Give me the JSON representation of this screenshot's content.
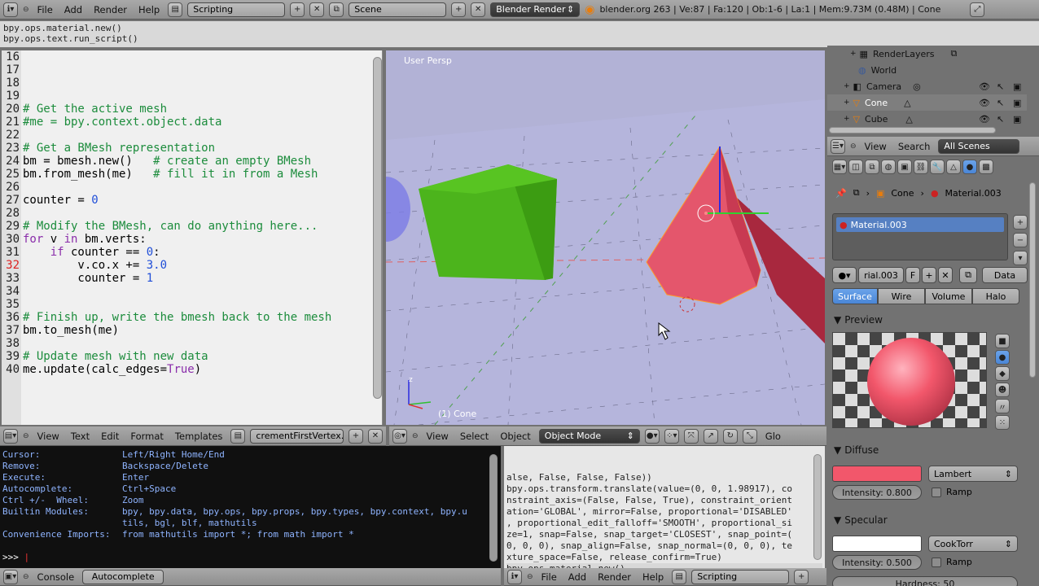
{
  "top_bar": {
    "menus": [
      "File",
      "Add",
      "Render",
      "Help"
    ],
    "layout": "Scripting",
    "scene": "Scene",
    "engine": "Blender Render",
    "stats": "blender.org 263 | Ve:87 | Fa:120 | Ob:1-6 | La:1 | Mem:9.73M (0.48M) | Cone"
  },
  "info_log": [
    "bpy.ops.material.new()",
    "bpy.ops.text.run_script()"
  ],
  "text_editor": {
    "lines": [
      {
        "n": "16",
        "segs": []
      },
      {
        "n": "17",
        "segs": []
      },
      {
        "n": "18",
        "segs": []
      },
      {
        "n": "19",
        "segs": []
      },
      {
        "n": "20",
        "segs": [
          {
            "t": "# Get the active mesh",
            "c": "cm"
          }
        ]
      },
      {
        "n": "21",
        "segs": [
          {
            "t": "#me = bpy.context.object.data",
            "c": "cm"
          }
        ]
      },
      {
        "n": "22",
        "segs": []
      },
      {
        "n": "23",
        "segs": [
          {
            "t": "# Get a BMesh representation",
            "c": "cm"
          }
        ]
      },
      {
        "n": "24",
        "segs": [
          {
            "t": "bm = bmesh.new()   ",
            "c": ""
          },
          {
            "t": "# create an empty BMesh",
            "c": "cm"
          }
        ]
      },
      {
        "n": "25",
        "segs": [
          {
            "t": "bm.from_mesh(me)   ",
            "c": ""
          },
          {
            "t": "# fill it in from a Mesh",
            "c": "cm"
          }
        ]
      },
      {
        "n": "26",
        "segs": []
      },
      {
        "n": "27",
        "segs": [
          {
            "t": "counter = ",
            "c": ""
          },
          {
            "t": "0",
            "c": "nm"
          }
        ]
      },
      {
        "n": "28",
        "segs": []
      },
      {
        "n": "29",
        "segs": [
          {
            "t": "# Modify the BMesh, can do anything here...",
            "c": "cm"
          }
        ]
      },
      {
        "n": "30",
        "segs": [
          {
            "t": "for",
            "c": "kw"
          },
          {
            "t": " v ",
            "c": ""
          },
          {
            "t": "in",
            "c": "kw"
          },
          {
            "t": " bm.verts:",
            "c": ""
          }
        ]
      },
      {
        "n": "31",
        "segs": [
          {
            "t": "    ",
            "c": ""
          },
          {
            "t": "if",
            "c": "kw"
          },
          {
            "t": " counter == ",
            "c": ""
          },
          {
            "t": "0",
            "c": "nm"
          },
          {
            "t": ":",
            "c": ""
          }
        ]
      },
      {
        "n": "32",
        "segs": [
          {
            "t": "        v.co.x += ",
            "c": ""
          },
          {
            "t": "3.0",
            "c": "nm"
          }
        ]
      },
      {
        "n": "33",
        "segs": [
          {
            "t": "        counter = ",
            "c": ""
          },
          {
            "t": "1",
            "c": "nm"
          }
        ]
      },
      {
        "n": "34",
        "segs": []
      },
      {
        "n": "35",
        "segs": []
      },
      {
        "n": "36",
        "segs": [
          {
            "t": "# Finish up, write the bmesh back to the mesh",
            "c": "cm"
          }
        ]
      },
      {
        "n": "37",
        "segs": [
          {
            "t": "bm.to_mesh(me)",
            "c": ""
          }
        ]
      },
      {
        "n": "38",
        "segs": []
      },
      {
        "n": "39",
        "segs": [
          {
            "t": "# Update mesh with new data",
            "c": "cm"
          }
        ]
      },
      {
        "n": "40",
        "segs": [
          {
            "t": "me.update(calc_edges=",
            "c": ""
          },
          {
            "t": "True",
            "c": "kw"
          },
          {
            "t": ")",
            "c": ""
          }
        ]
      }
    ],
    "menus": [
      "View",
      "Text",
      "Edit",
      "Format",
      "Templates"
    ],
    "filename": "crementFirstVertex.py"
  },
  "viewport": {
    "label": "User Persp",
    "object_label": "(1) Cone",
    "menus": [
      "View",
      "Select",
      "Object"
    ],
    "mode": "Object Mode",
    "orientation": "Glo",
    "axis_z": "z"
  },
  "console": {
    "lines": [
      [
        "Cursor:",
        "Left/Right Home/End"
      ],
      [
        "Remove:",
        "Backspace/Delete"
      ],
      [
        "Execute:",
        "Enter"
      ],
      [
        "Autocomplete:",
        "Ctrl+Space"
      ],
      [
        "Ctrl +/-  Wheel:",
        "Zoom"
      ],
      [
        "Builtin Modules:",
        "bpy, bpy.data, bpy.ops, bpy.props, bpy.types, bpy.context, bpy.u"
      ],
      [
        "",
        "tils, bgl, blf, mathutils"
      ],
      [
        "Convenience Imports:",
        "from mathutils import *; from math import *"
      ]
    ],
    "prompt": ">>> ",
    "tabs": [
      "Console",
      "Autocomplete"
    ]
  },
  "info_panel": {
    "lines": [
      "alse, False, False, False))",
      "bpy.ops.transform.translate(value=(0, 0, 1.98917), co",
      "nstraint_axis=(False, False, True), constraint_orient",
      "ation='GLOBAL', mirror=False, proportional='DISABLED'",
      ", proportional_edit_falloff='SMOOTH', proportional_si",
      "ze=1, snap=False, snap_target='CLOSEST', snap_point=(",
      "0, 0, 0), snap_align=False, snap_normal=(0, 0, 0), te",
      "xture_space=False, release_confirm=True)",
      "bpy.ops.material.new()",
      "bpy.ops.text.run_script()"
    ],
    "menus": [
      "File",
      "Add",
      "Render",
      "Help"
    ],
    "layout": "Scripting"
  },
  "outliner": {
    "items": [
      "RenderLayers",
      "World",
      "Camera",
      "Cone",
      "Cube"
    ],
    "menus": [
      "View",
      "Search"
    ],
    "filter": "All Scenes"
  },
  "properties": {
    "breadcrumb_object": "Cone",
    "breadcrumb_material": "Material.003",
    "slot": "Material.003",
    "mat_name": "rial.003",
    "fake": "F",
    "data": "Data",
    "tabs": [
      "Surface",
      "Wire",
      "Volume",
      "Halo"
    ],
    "preview": "Preview",
    "diffuse": "Diffuse",
    "diffuse_shader": "Lambert",
    "diffuse_intensity": "Intensity: 0.800",
    "ramp": "Ramp",
    "specular": "Specular",
    "specular_shader": "CookTorr",
    "specular_intensity": "Intensity: 0.500",
    "hardness": "Hardness: 50",
    "colors": {
      "diffuse": "#f2576b",
      "specular": "#ffffff"
    }
  }
}
